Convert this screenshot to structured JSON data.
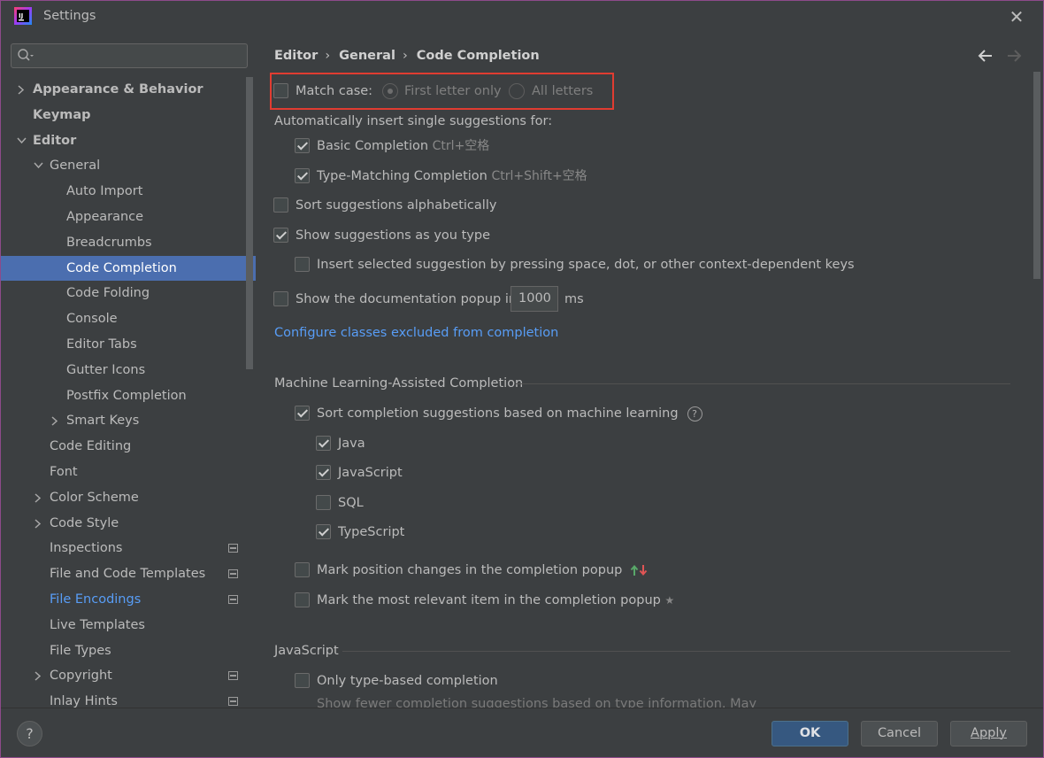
{
  "window": {
    "title": "Settings"
  },
  "search": {
    "placeholder": ""
  },
  "tree": [
    {
      "label": "Appearance & Behavior",
      "bold": true,
      "chevron": "right",
      "indent": 0
    },
    {
      "label": "Keymap",
      "bold": true,
      "chevron": "",
      "indent": 0
    },
    {
      "label": "Editor",
      "bold": true,
      "chevron": "down",
      "indent": 0
    },
    {
      "label": "General",
      "bold": false,
      "chevron": "down",
      "indent": 1
    },
    {
      "label": "Auto Import",
      "indent": 2
    },
    {
      "label": "Appearance",
      "indent": 2
    },
    {
      "label": "Breadcrumbs",
      "indent": 2
    },
    {
      "label": "Code Completion",
      "indent": 2,
      "selected": true
    },
    {
      "label": "Code Folding",
      "indent": 2
    },
    {
      "label": "Console",
      "indent": 2
    },
    {
      "label": "Editor Tabs",
      "indent": 2
    },
    {
      "label": "Gutter Icons",
      "indent": 2
    },
    {
      "label": "Postfix Completion",
      "indent": 2
    },
    {
      "label": "Smart Keys",
      "indent": 2,
      "chevron": "right"
    },
    {
      "label": "Code Editing",
      "indent": 1
    },
    {
      "label": "Font",
      "indent": 1
    },
    {
      "label": "Color Scheme",
      "indent": 1,
      "chevron": "right"
    },
    {
      "label": "Code Style",
      "indent": 1,
      "chevron": "right"
    },
    {
      "label": "Inspections",
      "indent": 1,
      "project_icon": true
    },
    {
      "label": "File and Code Templates",
      "indent": 1,
      "project_icon": true
    },
    {
      "label": "File Encodings",
      "indent": 1,
      "project_icon": true,
      "blue": true
    },
    {
      "label": "Live Templates",
      "indent": 1
    },
    {
      "label": "File Types",
      "indent": 1
    },
    {
      "label": "Copyright",
      "indent": 1,
      "chevron": "right",
      "project_icon": true
    },
    {
      "label": "Inlay Hints",
      "indent": 1,
      "project_icon": true
    }
  ],
  "breadcrumb": {
    "items": [
      "Editor",
      "General",
      "Code Completion"
    ],
    "separator": "›"
  },
  "content": {
    "match_case": {
      "label": "Match case:",
      "checked": false
    },
    "radio_first": {
      "label": "First letter only",
      "selected": true
    },
    "radio_all": {
      "label": "All letters",
      "selected": false
    },
    "auto_insert_label": "Automatically insert single suggestions for:",
    "basic_completion": {
      "label": "Basic Completion",
      "shortcut": "Ctrl+空格",
      "checked": true
    },
    "type_matching": {
      "label": "Type-Matching Completion",
      "shortcut": "Ctrl+Shift+空格",
      "checked": true
    },
    "sort_alpha": {
      "label": "Sort suggestions alphabetically",
      "checked": false
    },
    "show_as_type": {
      "label": "Show suggestions as you type",
      "checked": true
    },
    "insert_selected": {
      "label": "Insert selected suggestion by pressing space, dot, or other context-dependent keys",
      "checked": false
    },
    "doc_popup": {
      "label": "Show the documentation popup in",
      "value": "1000",
      "unit": "ms",
      "checked": false
    },
    "configure_link": "Configure classes excluded from completion",
    "ml_section": "Machine Learning-Assisted Completion",
    "ml_sort": {
      "label": "Sort completion suggestions based on machine learning",
      "checked": true,
      "help": "?"
    },
    "lang_java": {
      "label": "Java",
      "checked": true
    },
    "lang_js": {
      "label": "JavaScript",
      "checked": true
    },
    "lang_sql": {
      "label": "SQL",
      "checked": false
    },
    "lang_ts": {
      "label": "TypeScript",
      "checked": true
    },
    "mark_position": {
      "label": "Mark position changes in the completion popup",
      "checked": false
    },
    "mark_relevant": {
      "label": "Mark the most relevant item in the completion popup",
      "checked": false,
      "star": "★"
    },
    "js_section": "JavaScript",
    "only_type_based": {
      "label": "Only type-based completion",
      "checked": false
    },
    "only_type_based_desc": "Show fewer completion suggestions based on type information. May"
  },
  "buttons": {
    "ok": "OK",
    "cancel": "Cancel",
    "apply": "Apply",
    "help": "?"
  },
  "colors": {
    "background": "#3c3f41",
    "selection": "#4b6eaf",
    "link": "#589df6",
    "primary_button": "#365880",
    "highlight_box": "#e03c31"
  }
}
